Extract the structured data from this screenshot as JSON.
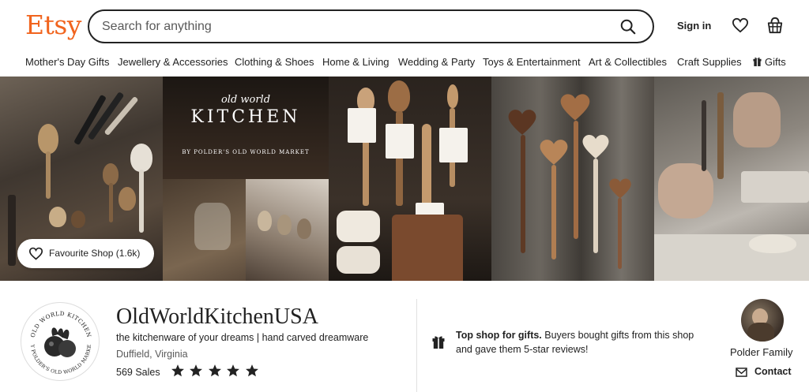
{
  "header": {
    "logo": "Etsy",
    "search_placeholder": "Search for anything",
    "sign_in": "Sign in",
    "brand_color": "#F1641E"
  },
  "categories": [
    "Mother's Day Gifts",
    "Jewellery & Accessories",
    "Clothing & Shoes",
    "Home & Living",
    "Wedding & Party",
    "Toys & Entertainment",
    "Art & Collectibles",
    "Craft Supplies",
    "Gifts"
  ],
  "banner": {
    "kitchen_small": "old world",
    "kitchen_big": "KITCHEN",
    "kitchen_sub": "BY POLDER'S OLD WORLD MARKET",
    "favourite_label": "Favourite Shop (1.6k)"
  },
  "shop": {
    "name": "OldWorldKitchenUSA",
    "tagline": "the kitchenware of your dreams | hand carved dreamware",
    "location": "Duffield, Virginia",
    "sales": "569 Sales",
    "rating": 5,
    "logo_text_top": "OLD WORLD KITCHEN",
    "logo_text_bottom": "BY POLDER'S OLD WORLD MARKET"
  },
  "top_shop": {
    "bold": "Top shop for gifts.",
    "text": " Buyers bought gifts from this shop and gave them 5-star reviews!"
  },
  "owner": {
    "name": "Polder Family",
    "contact": "Contact"
  },
  "icons": {
    "search": "search-icon",
    "favourites": "heart-icon",
    "cart": "basket-icon",
    "gift": "gift-icon",
    "star": "star-icon",
    "message": "envelope-icon"
  }
}
